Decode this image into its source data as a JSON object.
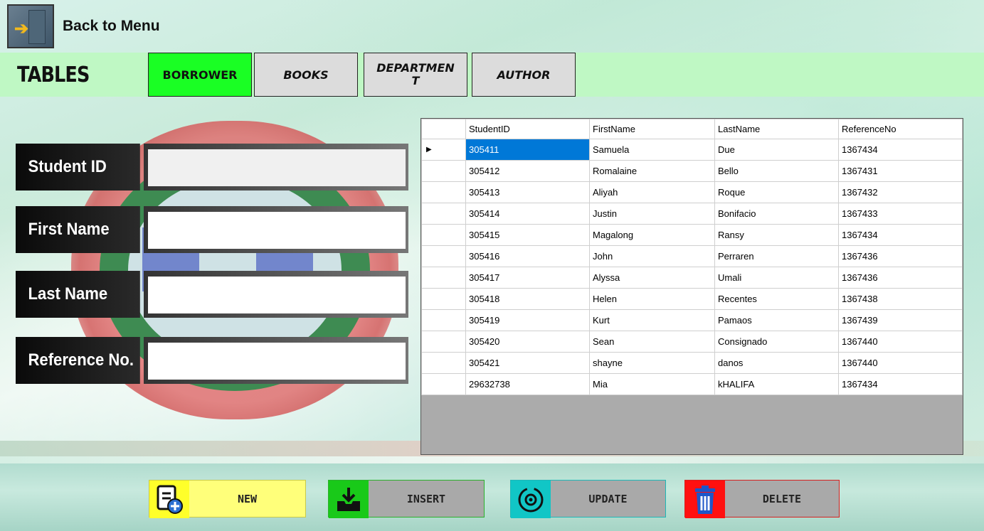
{
  "header": {
    "back_label": "Back to Menu"
  },
  "tables": {
    "title": "TABLES",
    "tabs": [
      {
        "label": "BORROWER",
        "active": true
      },
      {
        "label": "BOOKS",
        "active": false
      },
      {
        "label": "DEPARTMEN\nT",
        "active": false
      },
      {
        "label": "AUTHOR",
        "active": false
      }
    ]
  },
  "form": {
    "student_id_label": "Student ID",
    "student_id_value": "",
    "first_name_label": "First Name",
    "first_name_value": "",
    "last_name_label": "Last Name",
    "last_name_value": "",
    "reference_no_label": "Reference No.",
    "reference_no_value": ""
  },
  "grid": {
    "columns": [
      "StudentID",
      "FirstName",
      "LastName",
      "ReferenceNo"
    ],
    "rows": [
      [
        "305411",
        "Samuela",
        "Due",
        "1367434"
      ],
      [
        "305412",
        "Romalaine",
        "Bello",
        "1367431"
      ],
      [
        "305413",
        "Aliyah",
        "Roque",
        "1367432"
      ],
      [
        "305414",
        "Justin",
        "Bonifacio",
        "1367433"
      ],
      [
        "305415",
        "Magalong",
        "Ransy",
        "1367434"
      ],
      [
        "305416",
        "John",
        "Perraren",
        "1367436"
      ],
      [
        "305417",
        "Alyssa",
        "Umali",
        "1367436"
      ],
      [
        "305418",
        "Helen",
        "Recentes",
        "1367438"
      ],
      [
        "305419",
        "Kurt",
        "Pamaos",
        "1367439"
      ],
      [
        "305420",
        "Sean",
        "Consignado",
        "1367440"
      ],
      [
        "305421",
        "shayne",
        "danos",
        "1367440"
      ],
      [
        "29632738",
        "Mia",
        "kHALIFA",
        "1367434"
      ]
    ],
    "current_row_marker": "▶"
  },
  "actions": {
    "new_label": "NEW",
    "insert_label": "INSERT",
    "update_label": "UPDATE",
    "delete_label": "DELETE"
  },
  "icons": {
    "back": "exit-door-icon",
    "new": "new-document-icon",
    "insert": "download-tray-icon",
    "update": "refresh-gear-icon",
    "delete": "trash-can-icon"
  },
  "colors": {
    "tab_active": "#1aff24",
    "tables_bar": "#bff8c4",
    "selected_cell": "#0078d7",
    "new_button": "#ffff7a",
    "insert_accent": "#19c919",
    "update_accent": "#11c6c6",
    "delete_accent": "#ff1010"
  }
}
